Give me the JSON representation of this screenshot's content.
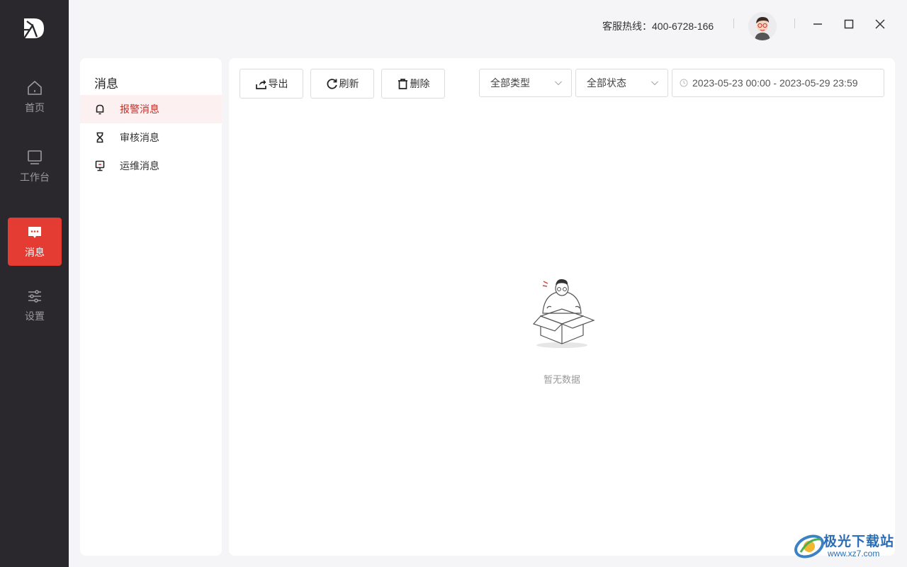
{
  "nav": {
    "items": [
      {
        "label": "首页",
        "icon": "home-icon"
      },
      {
        "label": "工作台",
        "icon": "monitor-icon"
      },
      {
        "label": "消息",
        "icon": "message-icon",
        "active": true
      },
      {
        "label": "设置",
        "icon": "sliders-icon"
      }
    ]
  },
  "topbar": {
    "hotline": "客服热线：400-6728-166"
  },
  "submenu": {
    "title": "消息",
    "items": [
      {
        "label": "报警消息",
        "icon": "bell-icon",
        "active": true
      },
      {
        "label": "审核消息",
        "icon": "hourglass-icon"
      },
      {
        "label": "运维消息",
        "icon": "maintenance-icon"
      }
    ]
  },
  "toolbar": {
    "export_label": "导出",
    "refresh_label": "刷新",
    "delete_label": "删除"
  },
  "filters": {
    "type_selected": "全部类型",
    "status_selected": "全部状态",
    "date_range": "2023-05-23 00:00 - 2023-05-29 23:59"
  },
  "empty": {
    "text": "暂无数据"
  },
  "watermark": {
    "title": "极光下载站",
    "url": "www.xz7.com"
  },
  "colors": {
    "accent": "#e43b33",
    "nav_bg": "#2a282c",
    "active_submenu_bg": "#fdf0f0"
  }
}
